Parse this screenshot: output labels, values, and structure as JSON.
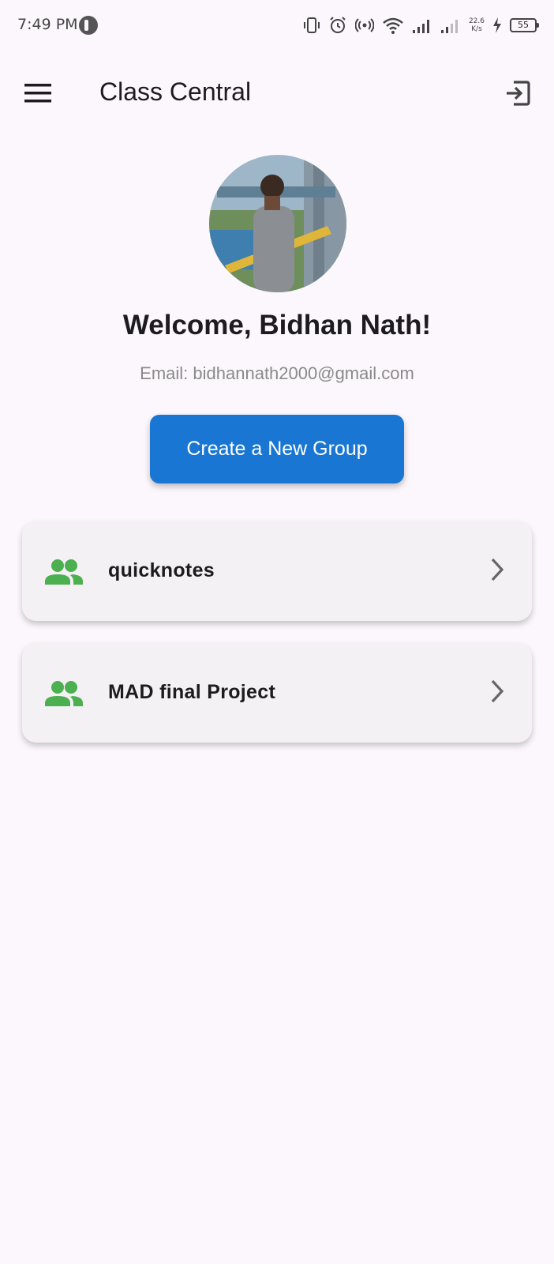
{
  "status_bar": {
    "time": "7:49 PM",
    "net_speed_value": "22.6",
    "net_speed_unit": "K/s",
    "battery": "55"
  },
  "app_bar": {
    "title": "Class Central"
  },
  "profile": {
    "welcome": "Welcome, Bidhan Nath!",
    "email": "Email: bidhannath2000@gmail.com"
  },
  "actions": {
    "create_group_label": "Create a New Group"
  },
  "groups": [
    {
      "name": "quicknotes"
    },
    {
      "name": "MAD final Project"
    }
  ],
  "icons": {
    "menu": "menu-icon",
    "logout": "logout-icon",
    "group": "group-icon",
    "chevron": "chevron-right-icon"
  },
  "colors": {
    "background": "#FCF7FC",
    "primary_button": "#1976D2",
    "group_icon": "#4CAF50",
    "card": "#F4F1F5"
  }
}
